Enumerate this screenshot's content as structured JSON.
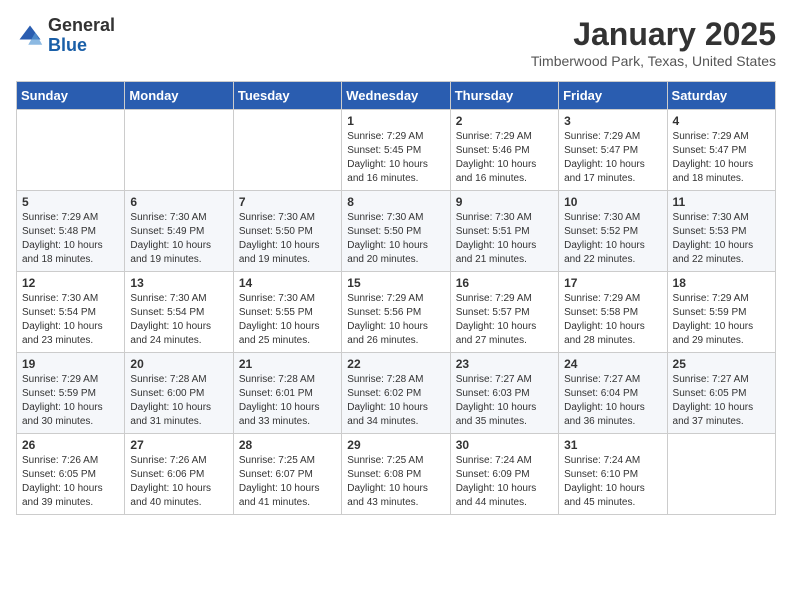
{
  "header": {
    "logo_general": "General",
    "logo_blue": "Blue",
    "month_title": "January 2025",
    "location": "Timberwood Park, Texas, United States"
  },
  "days_of_week": [
    "Sunday",
    "Monday",
    "Tuesday",
    "Wednesday",
    "Thursday",
    "Friday",
    "Saturday"
  ],
  "weeks": [
    [
      {
        "day": "",
        "info": ""
      },
      {
        "day": "",
        "info": ""
      },
      {
        "day": "",
        "info": ""
      },
      {
        "day": "1",
        "info": "Sunrise: 7:29 AM\nSunset: 5:45 PM\nDaylight: 10 hours\nand 16 minutes."
      },
      {
        "day": "2",
        "info": "Sunrise: 7:29 AM\nSunset: 5:46 PM\nDaylight: 10 hours\nand 16 minutes."
      },
      {
        "day": "3",
        "info": "Sunrise: 7:29 AM\nSunset: 5:47 PM\nDaylight: 10 hours\nand 17 minutes."
      },
      {
        "day": "4",
        "info": "Sunrise: 7:29 AM\nSunset: 5:47 PM\nDaylight: 10 hours\nand 18 minutes."
      }
    ],
    [
      {
        "day": "5",
        "info": "Sunrise: 7:29 AM\nSunset: 5:48 PM\nDaylight: 10 hours\nand 18 minutes."
      },
      {
        "day": "6",
        "info": "Sunrise: 7:30 AM\nSunset: 5:49 PM\nDaylight: 10 hours\nand 19 minutes."
      },
      {
        "day": "7",
        "info": "Sunrise: 7:30 AM\nSunset: 5:50 PM\nDaylight: 10 hours\nand 19 minutes."
      },
      {
        "day": "8",
        "info": "Sunrise: 7:30 AM\nSunset: 5:50 PM\nDaylight: 10 hours\nand 20 minutes."
      },
      {
        "day": "9",
        "info": "Sunrise: 7:30 AM\nSunset: 5:51 PM\nDaylight: 10 hours\nand 21 minutes."
      },
      {
        "day": "10",
        "info": "Sunrise: 7:30 AM\nSunset: 5:52 PM\nDaylight: 10 hours\nand 22 minutes."
      },
      {
        "day": "11",
        "info": "Sunrise: 7:30 AM\nSunset: 5:53 PM\nDaylight: 10 hours\nand 22 minutes."
      }
    ],
    [
      {
        "day": "12",
        "info": "Sunrise: 7:30 AM\nSunset: 5:54 PM\nDaylight: 10 hours\nand 23 minutes."
      },
      {
        "day": "13",
        "info": "Sunrise: 7:30 AM\nSunset: 5:54 PM\nDaylight: 10 hours\nand 24 minutes."
      },
      {
        "day": "14",
        "info": "Sunrise: 7:30 AM\nSunset: 5:55 PM\nDaylight: 10 hours\nand 25 minutes."
      },
      {
        "day": "15",
        "info": "Sunrise: 7:29 AM\nSunset: 5:56 PM\nDaylight: 10 hours\nand 26 minutes."
      },
      {
        "day": "16",
        "info": "Sunrise: 7:29 AM\nSunset: 5:57 PM\nDaylight: 10 hours\nand 27 minutes."
      },
      {
        "day": "17",
        "info": "Sunrise: 7:29 AM\nSunset: 5:58 PM\nDaylight: 10 hours\nand 28 minutes."
      },
      {
        "day": "18",
        "info": "Sunrise: 7:29 AM\nSunset: 5:59 PM\nDaylight: 10 hours\nand 29 minutes."
      }
    ],
    [
      {
        "day": "19",
        "info": "Sunrise: 7:29 AM\nSunset: 5:59 PM\nDaylight: 10 hours\nand 30 minutes."
      },
      {
        "day": "20",
        "info": "Sunrise: 7:28 AM\nSunset: 6:00 PM\nDaylight: 10 hours\nand 31 minutes."
      },
      {
        "day": "21",
        "info": "Sunrise: 7:28 AM\nSunset: 6:01 PM\nDaylight: 10 hours\nand 33 minutes."
      },
      {
        "day": "22",
        "info": "Sunrise: 7:28 AM\nSunset: 6:02 PM\nDaylight: 10 hours\nand 34 minutes."
      },
      {
        "day": "23",
        "info": "Sunrise: 7:27 AM\nSunset: 6:03 PM\nDaylight: 10 hours\nand 35 minutes."
      },
      {
        "day": "24",
        "info": "Sunrise: 7:27 AM\nSunset: 6:04 PM\nDaylight: 10 hours\nand 36 minutes."
      },
      {
        "day": "25",
        "info": "Sunrise: 7:27 AM\nSunset: 6:05 PM\nDaylight: 10 hours\nand 37 minutes."
      }
    ],
    [
      {
        "day": "26",
        "info": "Sunrise: 7:26 AM\nSunset: 6:05 PM\nDaylight: 10 hours\nand 39 minutes."
      },
      {
        "day": "27",
        "info": "Sunrise: 7:26 AM\nSunset: 6:06 PM\nDaylight: 10 hours\nand 40 minutes."
      },
      {
        "day": "28",
        "info": "Sunrise: 7:25 AM\nSunset: 6:07 PM\nDaylight: 10 hours\nand 41 minutes."
      },
      {
        "day": "29",
        "info": "Sunrise: 7:25 AM\nSunset: 6:08 PM\nDaylight: 10 hours\nand 43 minutes."
      },
      {
        "day": "30",
        "info": "Sunrise: 7:24 AM\nSunset: 6:09 PM\nDaylight: 10 hours\nand 44 minutes."
      },
      {
        "day": "31",
        "info": "Sunrise: 7:24 AM\nSunset: 6:10 PM\nDaylight: 10 hours\nand 45 minutes."
      },
      {
        "day": "",
        "info": ""
      }
    ]
  ]
}
